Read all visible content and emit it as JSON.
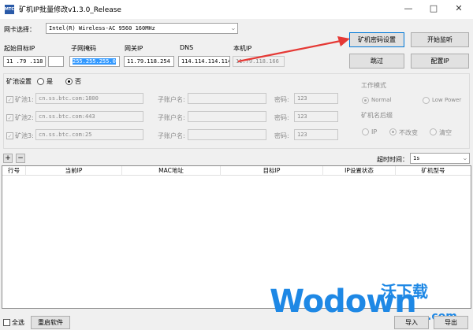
{
  "window": {
    "title": "矿机IP批量修改v1.3.0_Release",
    "icon": "app-icon",
    "icon_text": "MTC"
  },
  "nic": {
    "label": "网卡选择：",
    "value": "Intel(R) Wireless-AC 9560 160MHz"
  },
  "fields": {
    "start_ip_label": "起始目标IP",
    "start_ip_value": "11 .79 .118 .",
    "start_ip_last": "",
    "subnet_label": "子网掩码",
    "subnet_value": "255.255.255.0",
    "gateway_label": "网关IP",
    "gateway_value": "11.79.118.254",
    "dns_label": "DNS",
    "dns_value": "114.114.114.114",
    "local_ip_label": "本机IP",
    "local_ip_value": "11.79.118.166"
  },
  "buttons": {
    "password_settings": "矿机密码设置",
    "start_listen": "开始监听",
    "skip": "跳过",
    "config_ip": "配置IP",
    "add": "+",
    "remove": "−",
    "reboot_software": "重启软件",
    "import": "导入",
    "export": "导出"
  },
  "pool": {
    "settings_label": "矿池设置",
    "yes": "是",
    "no": "否",
    "selected": "否",
    "rows": [
      {
        "label": "矿池1:",
        "url": "cn.ss.btc.com:1800",
        "sub_label": "子账户名:",
        "sub_value": "",
        "pwd_label": "密码:",
        "pwd_value": "123"
      },
      {
        "label": "矿池2:",
        "url": "cn.ss.btc.com:443",
        "sub_label": "子账户名:",
        "sub_value": "",
        "pwd_label": "密码:",
        "pwd_value": "123"
      },
      {
        "label": "矿池3:",
        "url": "cn.ss.btc.com:25",
        "sub_label": "子账户名:",
        "sub_value": "",
        "pwd_label": "密码:",
        "pwd_value": "123"
      }
    ],
    "work_mode_label": "工作模式",
    "mode_normal": "Normal",
    "mode_low": "Low Power",
    "suffix_label": "矿机名后缀",
    "suffix_ip": "IP",
    "suffix_keep": "不改变",
    "suffix_clear": "清空"
  },
  "timeout": {
    "label": "超时时间：",
    "value": "1s"
  },
  "table": {
    "columns": [
      "行号",
      "当前IP",
      "MAC地址",
      "目标IP",
      "IP设置状态",
      "矿机型号"
    ]
  },
  "footer": {
    "select_all": "全选"
  },
  "watermark": {
    "brand": "Wodown",
    "domain": ".com",
    "chinese": "沃下载"
  },
  "colors": {
    "accent": "#0078d7",
    "arrow": "#e53935",
    "watermark": "#1e88e5"
  }
}
